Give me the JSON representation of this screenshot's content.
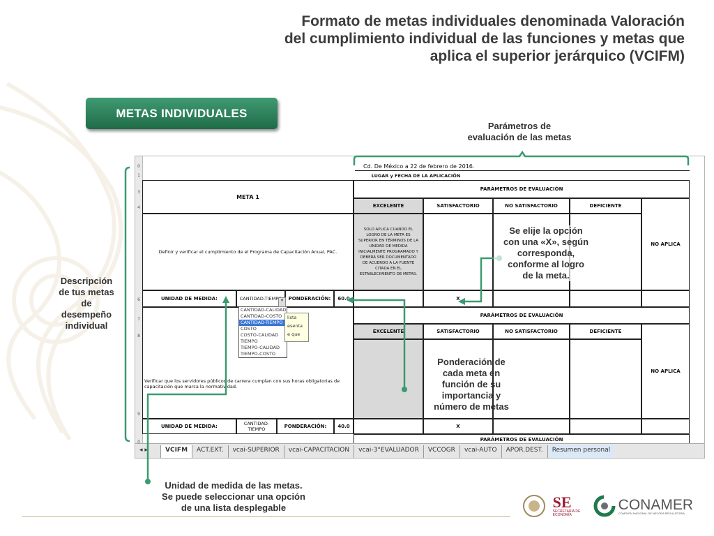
{
  "title": {
    "line1": "Formato de metas individuales denominada Valoración",
    "line2": "del cumplimiento individual de las funciones y metas que",
    "line3": "aplica el superior jerárquico (VCIFM)"
  },
  "metas_button": "METAS INDIVIDUALES",
  "annotations": {
    "parametros": [
      "Parámetros de",
      "evaluación de las metas"
    ],
    "descripcion": [
      "Descripción",
      "de tus metas",
      "de",
      "desempeño",
      "individual"
    ],
    "elije": [
      "Se elije la opción",
      "con una «X», según",
      "corresponda,",
      "conforme al logro",
      "de la meta."
    ],
    "ponderacion": [
      "Ponderación de",
      "cada meta en",
      "función de su",
      "importancia y",
      "número de metas"
    ],
    "unidad": [
      "Unidad de medida de las metas.",
      "Se puede seleccionar una opción",
      "de una lista desplegable"
    ]
  },
  "sheet": {
    "date_line": "Cd. De México a 22 de febrero de 2016.",
    "lugar_fecha": "LUGAR y FECHA DE LA APLICACIÓN",
    "meta1": "META 1",
    "param_header": "PARÁMETROS DE EVALUACIÓN",
    "cols": [
      "EXCELENTE",
      "SATISFACTORIO",
      "NO SATISFACTORIO",
      "DEFICIENTE"
    ],
    "no_aplica": "NO APLICA",
    "meta1_desc": "Definir y verificar el cumplimiento de el Programa de Capacitación Anual, PAC.",
    "excelente_note": "SOLO APLICA CUANDO EL LOGRO DE LA META ES SUPERIOR EN TÉRMINOS DE LA UNIDAD DE MEDIDA INICIALMENTE PROGRAMADO Y DEBERÁ SER DOCUMENTADO DE ACUERDO A LA FUENTE CITADA EN EL ESTABLECIMIENTO DE METAS.",
    "unidad_label": "UNIDAD DE MEDIDA:",
    "unidad_value": "CANTIDAD-TIEMPO",
    "ponderacion_label": "PONDERACIÓN:",
    "ponderacion_1": "60.0",
    "ponderacion_2": "40.0",
    "x_mark": "X",
    "meta2_desc": "Verificar que los servidores públicos de carrera cumplan con sus horas obligatorias de capacitación que marca la normatividad.",
    "dropdown_head": "CANTIDAD-CALIDAD",
    "dropdown_options": [
      "CANTIDAD-CALIDAD",
      "CANTIDAD-COSTO",
      "CANTIDAD-TIEMPO",
      "COSTO",
      "COSTO-CALIDAD",
      "TIEMPO",
      "TIEMPO-CALIDAD",
      "TIEMPO-COSTO"
    ],
    "dropdown_selected": 2,
    "tooltip": [
      "lista",
      "esenta",
      "e que"
    ],
    "row_numbers": [
      "0",
      "1",
      "2",
      "3",
      "4",
      "5",
      "6",
      "7",
      "8",
      "9",
      "0"
    ],
    "tabs": [
      "VCIFM",
      "ACT.EXT.",
      "vcai-SUPERIOR",
      "vcai-CAPACITACION",
      "vcai-3°EVALUADOR",
      "VCCOGR",
      "vcai-AUTO",
      "APOR.DEST.",
      "Resumen personal"
    ]
  },
  "logos": {
    "se": "SE",
    "se_sub": "SECRETARÍA DE ECONOMÍA",
    "conamer": "CONAMER",
    "conamer_sub": "COMISIÓN NACIONAL DE MEJORA REGULATORIA"
  },
  "colors": {
    "accent_green": "#2e8b62",
    "line_green": "#3a9a70"
  }
}
